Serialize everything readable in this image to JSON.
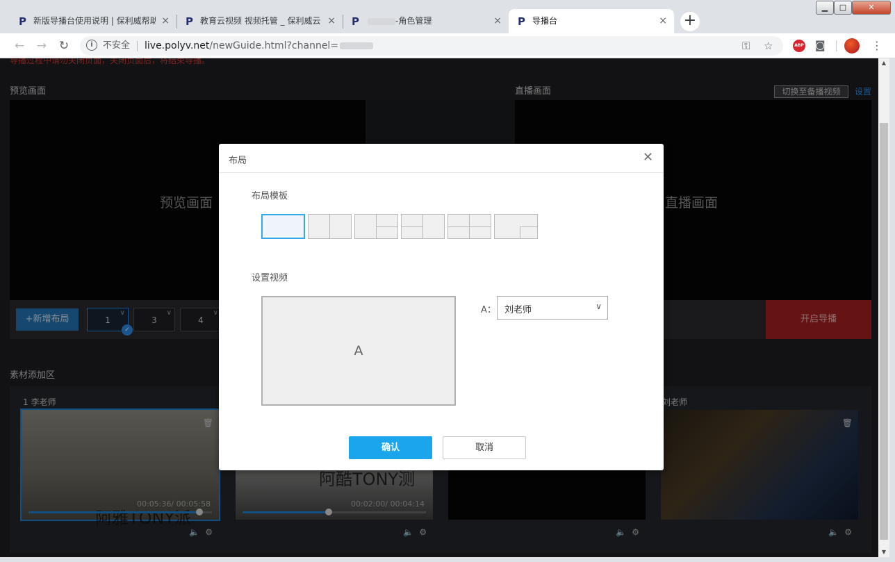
{
  "browser": {
    "tabs": [
      {
        "title": "新版导播台使用说明 | 保利威帮助",
        "active": false
      },
      {
        "title": "教育云视频 视频托管 _ 保利威云",
        "active": false
      },
      {
        "title": "-角色管理",
        "active": false
      },
      {
        "title": "导播台",
        "active": true
      }
    ],
    "new_tab": "+",
    "close_glyph": "×",
    "security_label": "不安全",
    "url_host": "live.polyv.net",
    "url_rest": "/newGuide.html?channel=",
    "favicon_letter": "P",
    "abp_label": "ABP"
  },
  "page": {
    "warning": "导播过程中请勿关闭页面，关闭页面后，将结束导播。",
    "preview_section_title": "预览画面",
    "preview_label": "预览画面",
    "live_section_title": "直播画面",
    "live_label": "直播画面",
    "switch_backup_button": "切换至备播视频",
    "settings_link": "设置",
    "add_layout_button": "+新增布局",
    "layout_slots": [
      "1",
      "3",
      "4"
    ],
    "selected_slot": "1",
    "start_button": "开启导播",
    "material_title": "素材添加区",
    "cards": [
      {
        "title": "1 李老师",
        "time": "00:05:36/ 00:05:58",
        "progress": 0.93,
        "overlay": "阿雅TONY派",
        "selected": true
      },
      {
        "title": "",
        "time": "00:02:00/ 00:04:14",
        "progress": 0.47,
        "overlay": "阿酷TONY测",
        "selected": false
      },
      {
        "title": "",
        "time": "",
        "progress": 0,
        "overlay": "",
        "selected": false
      },
      {
        "title": "刘老师",
        "time": "",
        "progress": 0,
        "overlay": "",
        "selected": false
      }
    ]
  },
  "modal": {
    "title": "布局",
    "template_section": "布局模板",
    "selected_template_index": 0,
    "video_section": "设置视频",
    "slot_letter": "A",
    "slot_label": "A：",
    "slot_value": "刘老师",
    "confirm_button": "确认",
    "cancel_button": "取消"
  },
  "colors": {
    "accent": "#1aa5ec",
    "start_button": "#a4201f",
    "warning_text": "#c93a33",
    "page_bg": "#1d1e22"
  }
}
